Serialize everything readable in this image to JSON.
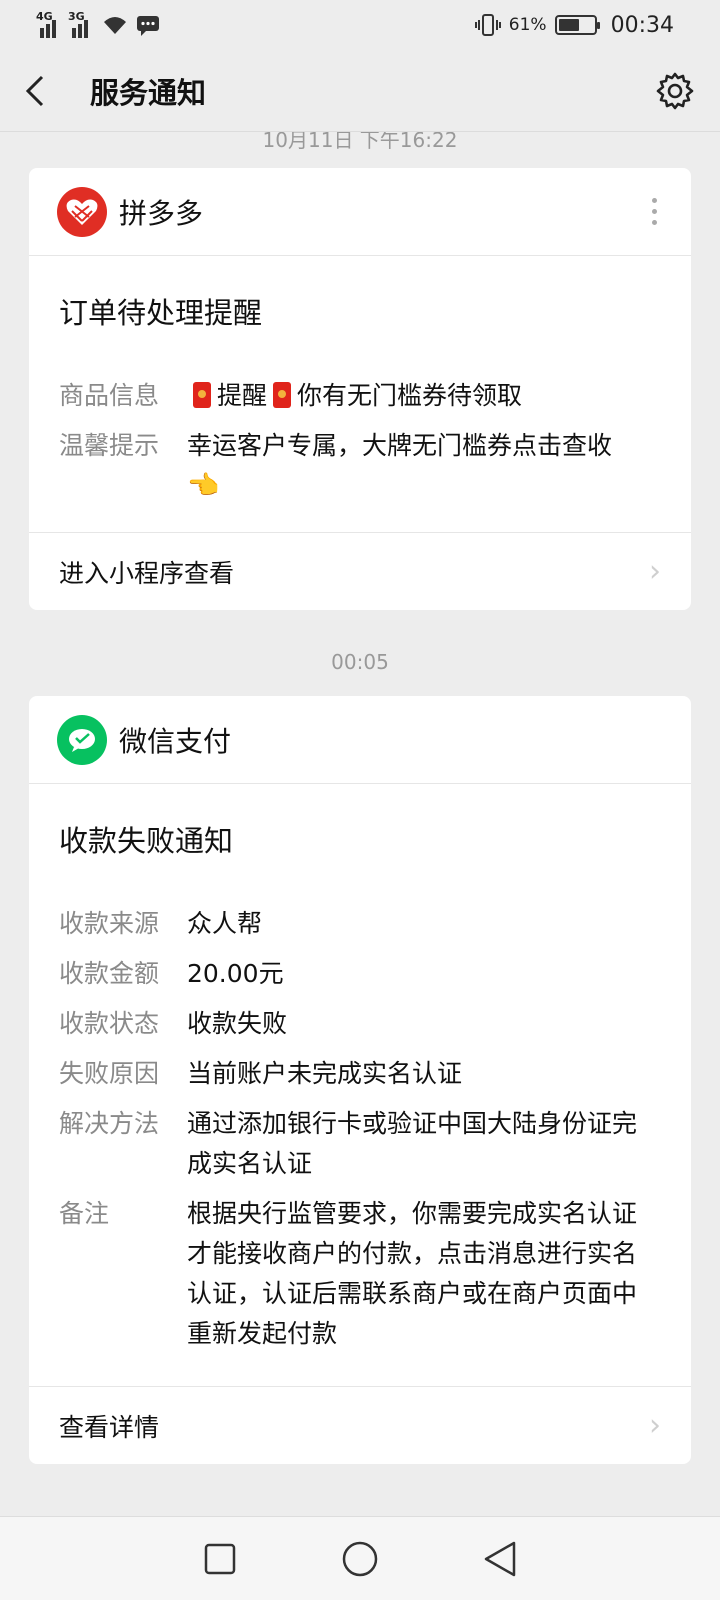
{
  "status_bar": {
    "net1": "4G",
    "net2": "3G",
    "battery_pct": "61%",
    "battery_level": 0.61,
    "time": "00:34"
  },
  "header": {
    "title": "服务通知"
  },
  "partial_time": "10月11日 下午16:22",
  "cards": [
    {
      "brand": "拼多多",
      "title": "订单待处理提醒",
      "rows": [
        {
          "key": "商品信息",
          "value_a": "提醒",
          "value_b": "你有无门槛券待领取"
        },
        {
          "key": "温馨提示",
          "value": "幸运客户专属，大牌无门槛券点击查收",
          "emoji": "👈"
        }
      ],
      "footer": "进入小程序查看"
    },
    {
      "time": "00:05",
      "brand": "微信支付",
      "title": "收款失败通知",
      "rows": [
        {
          "key": "收款来源",
          "value": "众人帮"
        },
        {
          "key": "收款金额",
          "value": "20.00元"
        },
        {
          "key": "收款状态",
          "value": "收款失败"
        },
        {
          "key": "失败原因",
          "value": "当前账户未完成实名认证"
        },
        {
          "key": "解决方法",
          "value": "通过添加银行卡或验证中国大陆身份证完成实名认证"
        },
        {
          "key": "备注",
          "value": "根据央行监管要求，你需要完成实名认证才能接收商户的付款，点击消息进行实名认证，认证后需联系商户或在商户页面中重新发起付款"
        }
      ],
      "footer": "查看详情"
    }
  ],
  "colors": {
    "pdd_red": "#e02e24",
    "wechat_green": "#07c160"
  }
}
